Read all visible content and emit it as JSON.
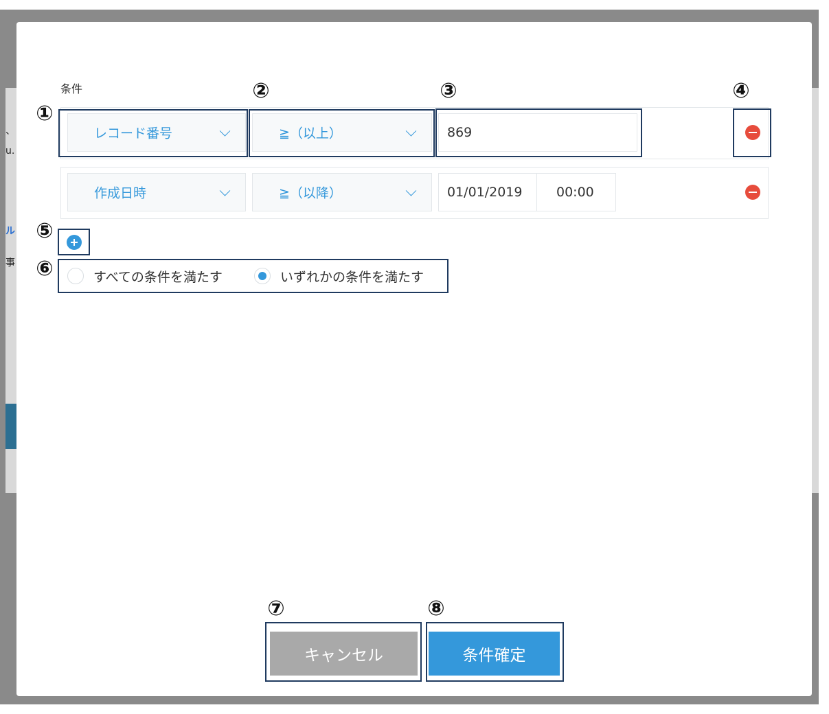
{
  "background": {
    "fragments": [
      "、",
      "u.",
      "ル",
      "事"
    ]
  },
  "dialog": {
    "section_label": "条件",
    "rows": [
      {
        "field": "レコード番号",
        "operator": "≧（以上）",
        "value": "869"
      },
      {
        "field": "作成日時",
        "operator": "≧（以降）",
        "date": "01/01/2019",
        "time": "00:00"
      }
    ],
    "match_options": [
      {
        "label": "すべての条件を満たす",
        "selected": false
      },
      {
        "label": "いずれかの条件を満たす",
        "selected": true
      }
    ],
    "buttons": {
      "cancel": "キャンセル",
      "confirm": "条件確定"
    }
  },
  "annotations": [
    "①",
    "②",
    "③",
    "④",
    "⑤",
    "⑥",
    "⑦",
    "⑧"
  ],
  "colors": {
    "accent": "#3498db",
    "danger": "#e74c3c",
    "highlight": "#1f3a5f",
    "cancel_button": "#a9a9a9"
  }
}
